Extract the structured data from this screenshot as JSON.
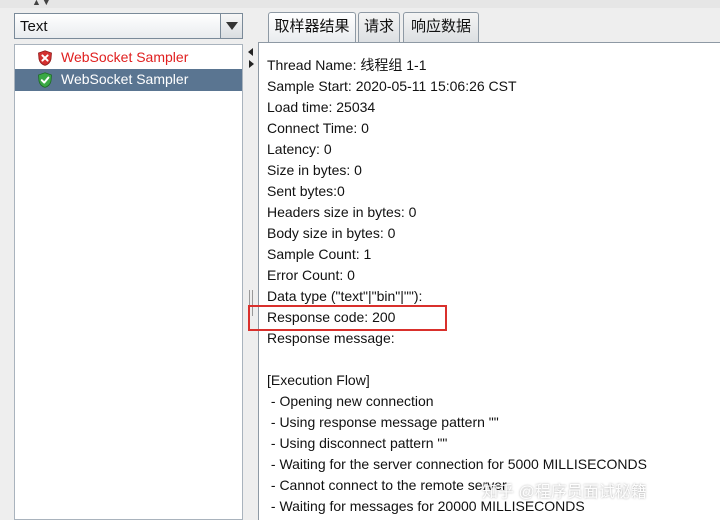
{
  "filter_combo": {
    "value": "Text"
  },
  "tree": {
    "items": [
      {
        "label": "WebSocket Sampler",
        "status": "error"
      },
      {
        "label": "WebSocket Sampler",
        "status": "success"
      }
    ]
  },
  "tabs": [
    {
      "label": "取样器结果",
      "active": true
    },
    {
      "label": "请求",
      "active": false
    },
    {
      "label": "响应数据",
      "active": false
    }
  ],
  "result": {
    "lines": [
      "Thread Name: 线程组 1-1",
      "Sample Start: 2020-05-11 15:06:26 CST",
      "Load time: 25034",
      "Connect Time: 0",
      "Latency: 0",
      "Size in bytes: 0",
      "Sent bytes:0",
      "Headers size in bytes: 0",
      "Body size in bytes: 0",
      "Sample Count: 1",
      "Error Count: 0",
      "Data type (\"text\"|\"bin\"|\"\"):",
      "Response code: 200",
      "Response message:",
      "",
      "[Execution Flow]",
      " - Opening new connection",
      " - Using response message pattern \"\"",
      " - Using disconnect pattern \"\"",
      " - Waiting for the server connection for 5000 MILLISECONDS",
      " - Cannot connect to the remote server",
      " - Waiting for messages for 20000 MILLISECONDS"
    ]
  },
  "watermark": "知乎 @程序员面试秘籍",
  "colors": {
    "error_text": "#e02020",
    "selected_bg": "#5a7591",
    "highlight_border": "#d9302c"
  }
}
